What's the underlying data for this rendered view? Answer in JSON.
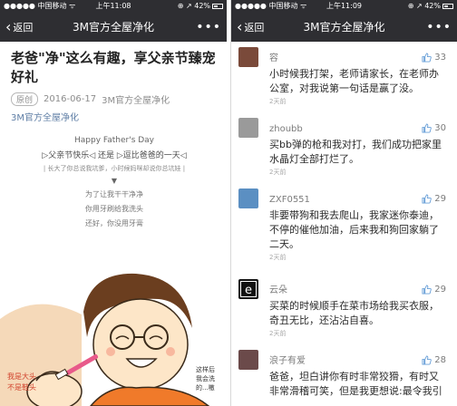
{
  "left": {
    "status": {
      "carrier": "●●●●● 中国移动 ᯤ",
      "time": "上午11:08",
      "battery": "⊕ ↗ 42%"
    },
    "nav": {
      "back": "返回",
      "title": "3M官方全屋净化",
      "more": "•••"
    },
    "article": {
      "title": "老爸\"净\"这么有趣，享父亲节臻宠好礼",
      "badge": "原创",
      "date": "2016-06-17",
      "author": "3M官方全屋净化",
      "account_link": "3M官方全屋净化"
    },
    "poster": {
      "heading": "Happy Father's Day",
      "subtitle": "▷父亲节快乐◁ 还是 ▷逗比爸爸的一天◁",
      "note": "| 长大了你总说我坑爹，小时候妈咪却说你总坑娃 |",
      "arrow": "▼",
      "lines": [
        "为了让我干干净净",
        "你用牙刷给我洗头",
        "还好，你没用牙膏"
      ]
    },
    "illustration": {
      "text_left_1": "我是大头",
      "text_left_2": "不是鞋头",
      "text_right_1": "这样后",
      "text_right_2": "我会洗",
      "text_right_3": "的...嗷"
    }
  },
  "right": {
    "status": {
      "carrier": "●●●●● 中国移动 ᯤ",
      "time": "上午11:09",
      "battery": "⊕ ↗ 42%"
    },
    "nav": {
      "back": "返回",
      "title": "3M官方全屋净化",
      "more": "•••"
    },
    "comments": [
      {
        "name": "容",
        "likes": "33",
        "text": "小时候我打架，老师请家长，在老师办公室，对我说第一句话是赢了没。",
        "time": "2天前",
        "avatar_color": "#7a4a3a"
      },
      {
        "name": "zhoubb",
        "likes": "30",
        "text": "买bb弹的枪和我对打，我们成功把家里水晶灯全部打烂了。",
        "time": "2天前",
        "avatar_color": "#9a9a9a"
      },
      {
        "name": "ZXF0551",
        "likes": "29",
        "text": "非要带狗和我去爬山，我家迷你泰迪，不停的催他加油，后来我和狗回家躺了二天。",
        "time": "2天前",
        "avatar_color": "#5b8fc2"
      },
      {
        "name": "云朵",
        "likes": "29",
        "text": "买菜的时候顺手在菜市场给我买衣服，奇丑无比，还沾沾自喜。",
        "time": "2天前",
        "avatar_color": "#111111"
      },
      {
        "name": "浪子有爱",
        "likes": "28",
        "text": "爸爸，坦白讲你有时非常狡猾，有时又非常滑稽可笑，但是我更想说:最令我引",
        "time": "",
        "avatar_color": "#6b4a4a"
      }
    ],
    "like_color": "#6aa0d8"
  }
}
